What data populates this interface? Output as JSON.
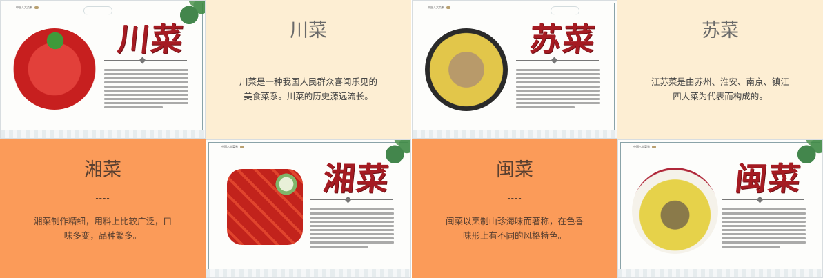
{
  "brand_text": "中国八大菜系",
  "cards": {
    "chuan": {
      "title": "川菜",
      "heading": "川菜",
      "divider": "----",
      "desc": "川菜是一种我国人民群众喜闻乐见的美食菜系。川菜的历史源远流长。"
    },
    "su": {
      "title": "苏菜",
      "heading": "苏菜",
      "divider": "----",
      "desc": "江苏菜是由苏州、淮安、南京、镇江四大菜为代表而构成的。"
    },
    "xiang": {
      "title": "湘菜",
      "heading": "湘菜",
      "divider": "----",
      "desc": "湘菜制作精细，用料上比较广泛，口味多变，品种繁多。"
    },
    "min": {
      "title": "闽菜",
      "heading": "闽菜",
      "divider": "----",
      "desc": "闽菜以烹制山珍海味而著称，在色香味形上有不同的风格特色。"
    }
  },
  "colors": {
    "title_red": "#a51b22",
    "cream": "#fdeed3",
    "orange": "#fb9b59"
  }
}
